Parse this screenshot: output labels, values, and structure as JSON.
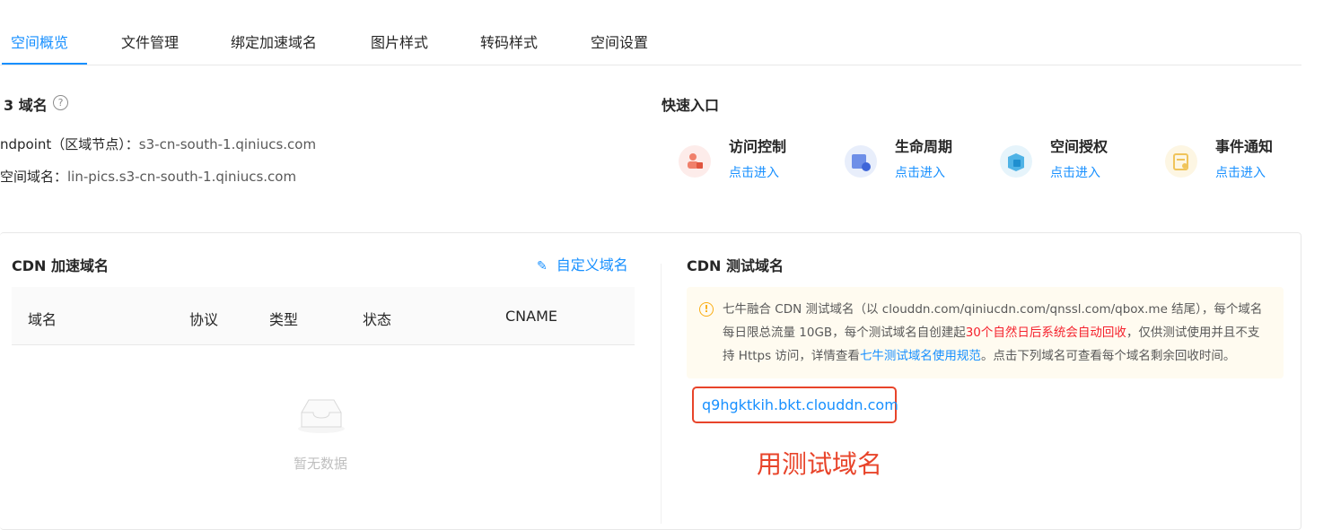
{
  "tabs": [
    {
      "label": "空间概览",
      "active": true
    },
    {
      "label": "文件管理"
    },
    {
      "label": "绑定加速域名"
    },
    {
      "label": "图片样式"
    },
    {
      "label": "转码样式"
    },
    {
      "label": "空间设置"
    }
  ],
  "s3": {
    "title": "3 域名",
    "help_icon": "question-circle-icon",
    "endpoint_label": "ndpoint（区域节点）：",
    "endpoint_value": "s3-cn-south-1.qiniucs.com",
    "space_domain_label": "空间域名：",
    "space_domain_value": "lin-pics.s3-cn-south-1.qiniucs.com"
  },
  "quick": {
    "title": "快速入口",
    "items": [
      {
        "label": "访问控制",
        "link": "点击进入",
        "icon": "access-control-icon",
        "color": "#fdecea"
      },
      {
        "label": "生命周期",
        "link": "点击进入",
        "icon": "lifecycle-icon",
        "color": "#e8eefb"
      },
      {
        "label": "空间授权",
        "link": "点击进入",
        "icon": "space-auth-icon",
        "color": "#e6f4fb"
      },
      {
        "label": "事件通知",
        "link": "点击进入",
        "icon": "event-notify-icon",
        "color": "#fdf6e3"
      }
    ]
  },
  "cdn": {
    "title": "CDN 加速域名",
    "custom_link": "自定义域名",
    "columns": [
      "域名",
      "协议",
      "类型",
      "状态",
      "CNAME"
    ],
    "empty_text": "暂无数据"
  },
  "test": {
    "title": "CDN 测试域名",
    "alert_1": "七牛融合 CDN 测试域名（以 clouddn.com/qiniucdn.com/qnssl.com/qbox.me 结尾），每个域名每日限总流量 10GB，每个测试域名自创建起",
    "alert_red": "30个自然日后系统会自动回收",
    "alert_2": "，仅供测试使用并且不支持 Https 访问，详情查看",
    "alert_link": "七牛测试域名使用规范",
    "alert_3": "。点击下列域名可查看每个域名剩余回收时间。",
    "domain": "q9hgktkih.bkt.clouddn.com",
    "annotation": "用测试域名"
  },
  "colors": {
    "accent": "#1890ff",
    "annotation": "#e8442a",
    "warning": "#faad14"
  }
}
